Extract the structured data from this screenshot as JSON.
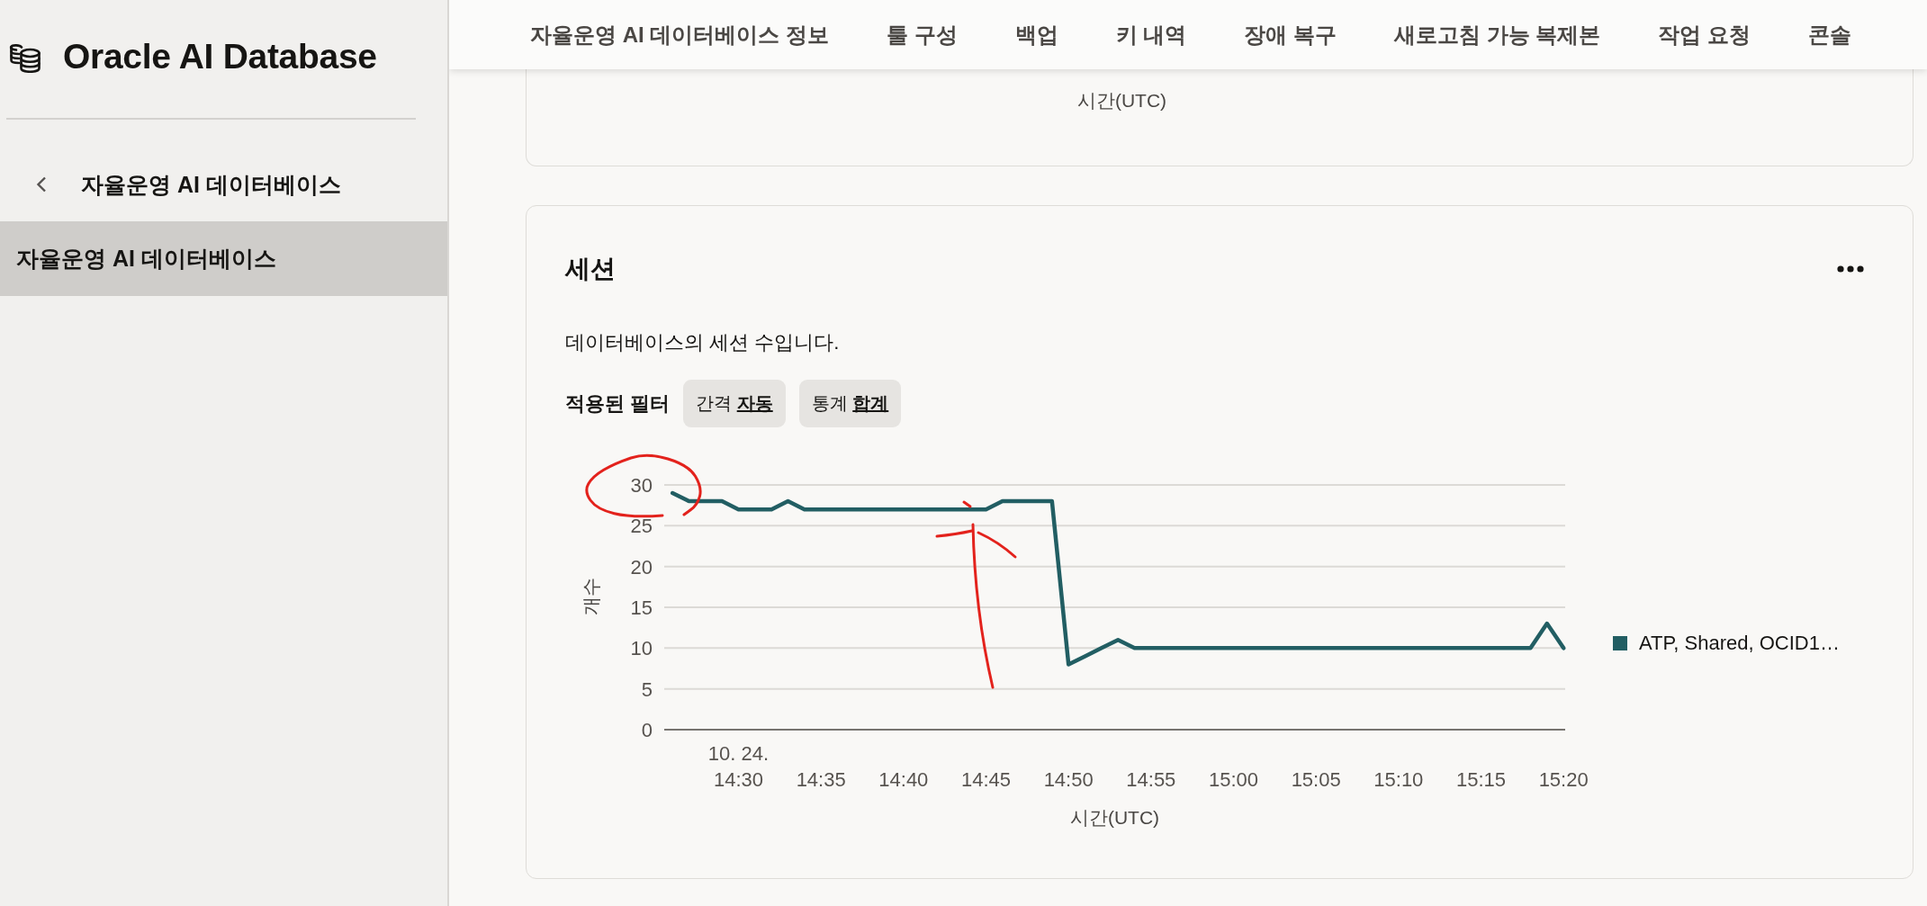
{
  "sidebar": {
    "title": "Oracle AI Database",
    "back_link": "자율운영 AI 데이터베이스",
    "items": [
      {
        "label": "자율운영 AI 데이터베이스",
        "selected": true
      }
    ]
  },
  "tabs": [
    "자율운영 AI 데이터베이스 정보",
    "툴 구성",
    "백업",
    "키 내역",
    "장애 복구",
    "새로고침 가능 복제본",
    "작업 요청",
    "콘솔"
  ],
  "previous_card": {
    "xlabel": "시간(UTC)"
  },
  "sessions_card": {
    "title": "세션",
    "description": "데이터베이스의 세션 수입니다.",
    "filters_label": "적용된 필터",
    "filters": [
      {
        "name": "간격",
        "value": "자동"
      },
      {
        "name": "통계",
        "value": "합계"
      }
    ],
    "chart_data": {
      "type": "line",
      "xlabel": "시간(UTC)",
      "ylabel": "개수",
      "grid": true,
      "x": [
        866,
        867,
        868,
        869,
        870,
        871,
        872,
        873,
        874,
        875,
        876,
        877,
        878,
        879,
        880,
        881,
        882,
        883,
        884,
        885,
        886,
        887,
        888,
        889,
        890,
        891,
        892,
        893,
        894,
        895,
        896,
        897,
        898,
        899,
        900,
        901,
        902,
        903,
        904,
        905,
        906,
        907,
        908,
        909,
        910,
        911,
        912,
        913,
        914,
        915,
        916,
        917,
        918,
        919,
        920
      ],
      "series": [
        {
          "name": "ATP, Shared, OCID1…",
          "color": "#225e63",
          "values": [
            29,
            28,
            28,
            28,
            27,
            27,
            27,
            28,
            27,
            27,
            27,
            27,
            27,
            27,
            27,
            27,
            27,
            27,
            27,
            27,
            28,
            28,
            28,
            28,
            8,
            9,
            10,
            11,
            10,
            10,
            10,
            10,
            10,
            10,
            10,
            10,
            10,
            10,
            10,
            10,
            10,
            10,
            10,
            10,
            10,
            10,
            10,
            10,
            10,
            10,
            10,
            10,
            10,
            13,
            10
          ]
        }
      ],
      "xlim": [
        865.5,
        920.1
      ],
      "ylim": [
        0,
        30
      ],
      "yticks": [
        0,
        5,
        10,
        15,
        20,
        25,
        30
      ],
      "xticks": [
        {
          "value": 870,
          "label": "10. 24.\n14:30"
        },
        {
          "value": 875,
          "label": "14:35"
        },
        {
          "value": 880,
          "label": "14:40"
        },
        {
          "value": 885,
          "label": "14:45"
        },
        {
          "value": 890,
          "label": "14:50"
        },
        {
          "value": 895,
          "label": "14:55"
        },
        {
          "value": 900,
          "label": "15:00"
        },
        {
          "value": 905,
          "label": "15:05"
        },
        {
          "value": 910,
          "label": "15:10"
        },
        {
          "value": 915,
          "label": "15:15"
        },
        {
          "value": 920,
          "label": "15:20"
        }
      ]
    }
  }
}
